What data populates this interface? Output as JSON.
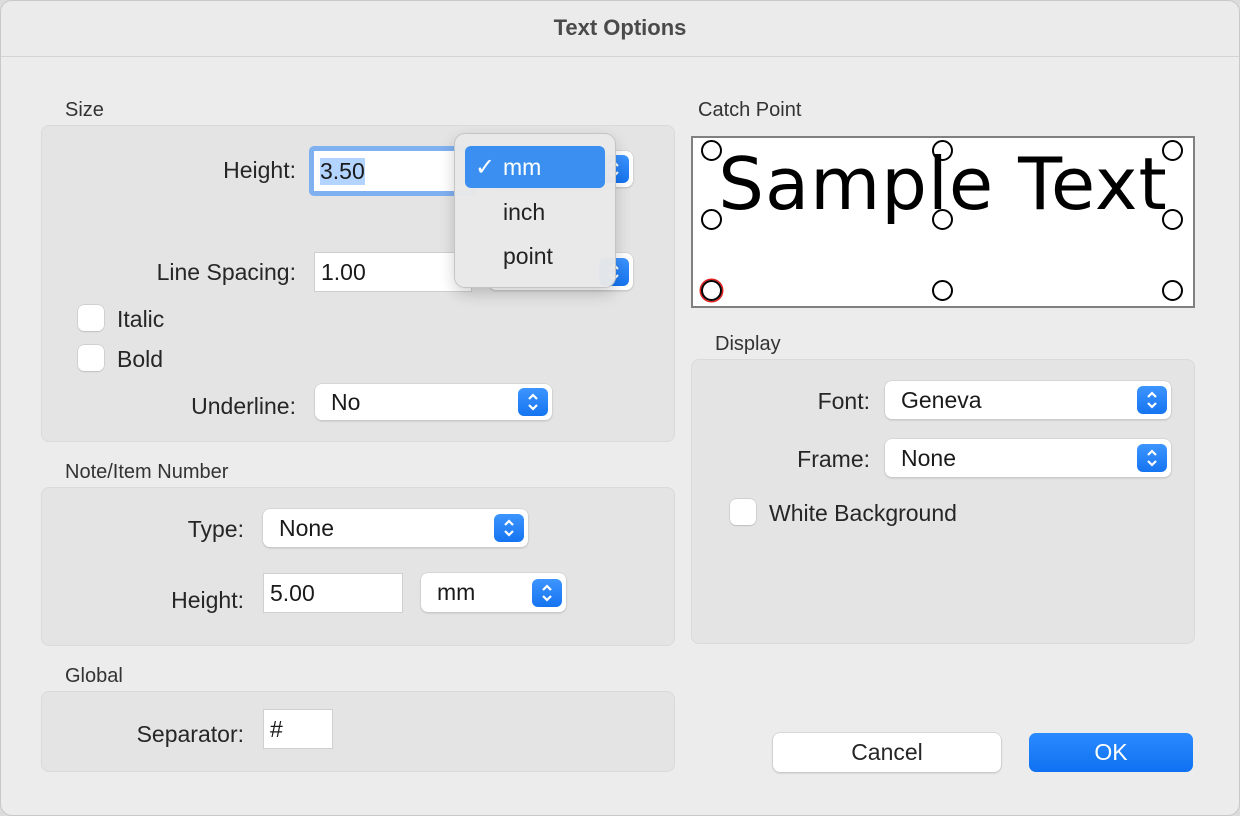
{
  "window": {
    "title": "Text Options"
  },
  "size": {
    "section_label": "Size",
    "height_label": "Height:",
    "height_value": "3.50",
    "line_spacing_label": "Line Spacing:",
    "line_spacing_value": "1.00",
    "italic_label": "Italic",
    "italic_checked": false,
    "bold_label": "Bold",
    "bold_checked": false,
    "underline_label": "Underline:",
    "underline_value": "No"
  },
  "unit_menu": {
    "items": [
      {
        "label": "mm",
        "selected": true,
        "check": "✓"
      },
      {
        "label": "inch"
      },
      {
        "label": "point"
      }
    ]
  },
  "note": {
    "section_label": "Note/Item Number",
    "type_label": "Type:",
    "type_value": "None",
    "height_label": "Height:",
    "height_value": "5.00",
    "unit_value": "mm"
  },
  "global": {
    "section_label": "Global",
    "separator_label": "Separator:",
    "separator_value": "#"
  },
  "catch_point": {
    "section_label": "Catch Point",
    "sample_text": "Sample Text",
    "selected_point": "bottom-left",
    "selected_color": "#e02020"
  },
  "display": {
    "section_label": "Display",
    "font_label": "Font:",
    "font_value": "Geneva",
    "frame_label": "Frame:",
    "frame_value": "None",
    "white_bg_label": "White Background",
    "white_bg_checked": false
  },
  "buttons": {
    "cancel": "Cancel",
    "ok": "OK"
  },
  "colors": {
    "accent": "#1a7cf5",
    "selection": "#b3d4ff"
  }
}
